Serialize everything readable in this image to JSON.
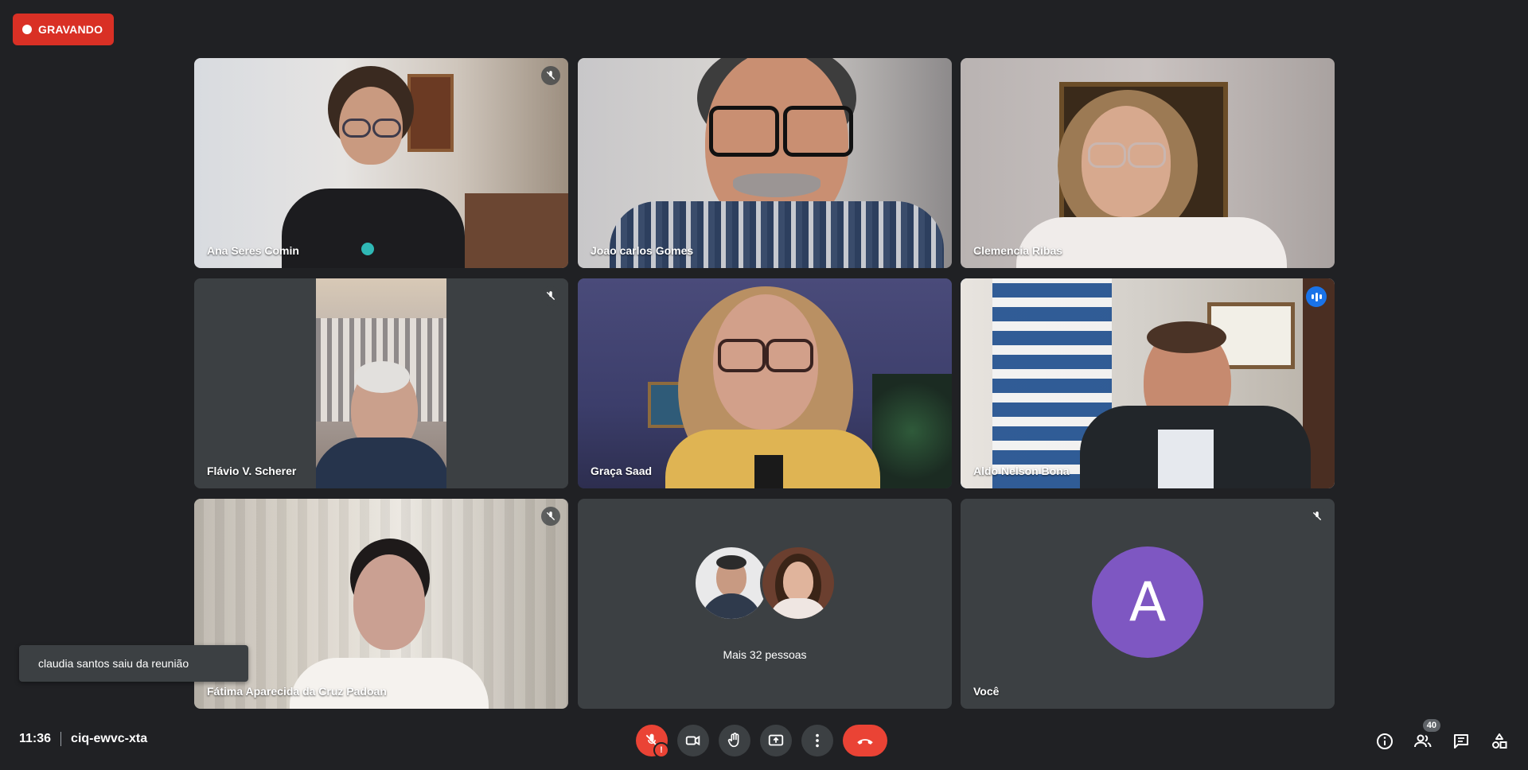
{
  "recording": {
    "label": "GRAVANDO",
    "color": "#d93025"
  },
  "participants": [
    {
      "name": "Ana Seres Comin",
      "muted": true
    },
    {
      "name": "Joao carlos Gomes",
      "muted": false
    },
    {
      "name": "Clemencia Ribas",
      "muted": false
    },
    {
      "name": "Flávio V. Scherer",
      "muted": true
    },
    {
      "name": "Graça Saad",
      "muted": false
    },
    {
      "name": "Aldo Nelson Bona",
      "muted": false,
      "speaking": true
    },
    {
      "name": "Fátima Aparecida da Cruz Padoan",
      "muted": true
    }
  ],
  "more_people": {
    "label": "Mais 32 pessoas"
  },
  "self": {
    "name": "Você",
    "initial": "A",
    "avatar_color": "#7e57c2",
    "muted": true
  },
  "toast": {
    "text": "claudia santos saiu da reunião"
  },
  "meeting": {
    "time": "11:36",
    "code": "ciq-ewvc-xta"
  },
  "controls": [
    "mic-off",
    "camera",
    "raise-hand",
    "present",
    "more-options",
    "leave-call"
  ],
  "right_panel": {
    "people_count": "40",
    "icons": [
      "info",
      "people",
      "chat",
      "activities"
    ]
  },
  "colors": {
    "background": "#202124",
    "tile": "#3c4043",
    "accent": "#8ab4f8",
    "danger": "#ea4335"
  }
}
